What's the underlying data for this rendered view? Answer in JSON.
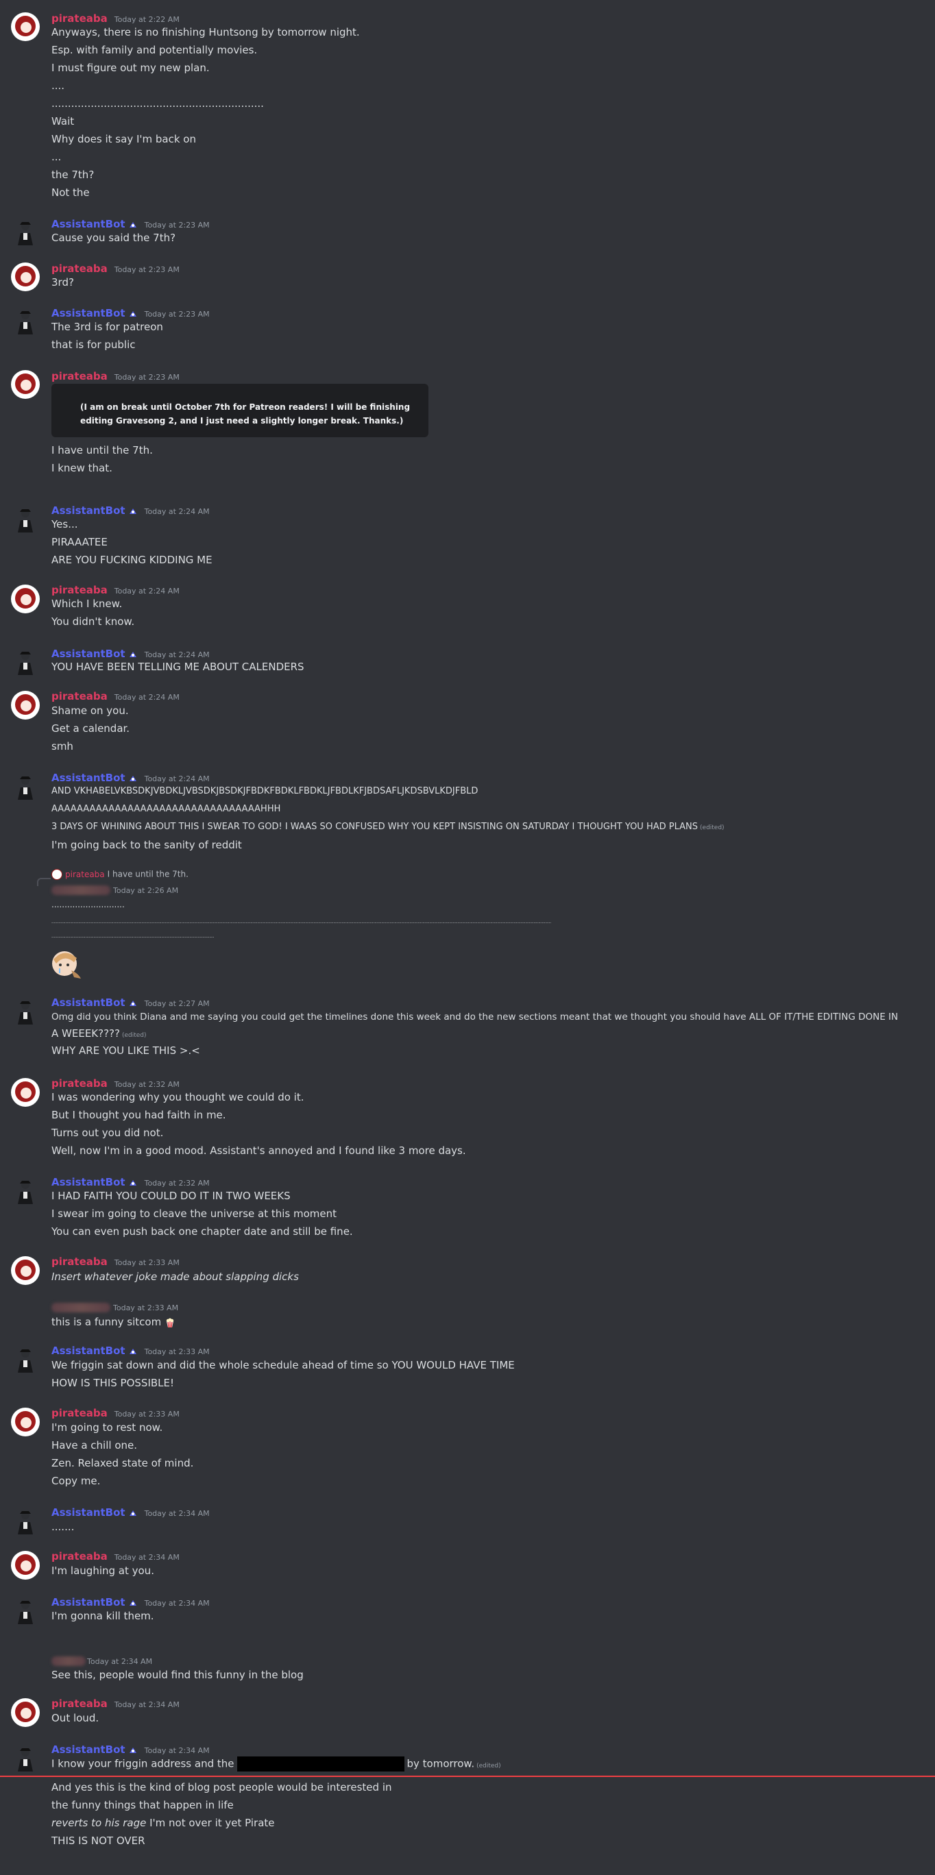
{
  "users": {
    "pirate": "pirateaba",
    "bot": "AssistantBot"
  },
  "colors": {
    "pirate": "#e03c62",
    "bot": "#5865f2",
    "background": "#313338"
  },
  "messages": {
    "m1": {
      "ts": "Today at 2:22 AM",
      "lines": [
        "Anyways, there is no finishing Huntsong by tomorrow night.",
        "Esp. with family and potentially movies.",
        "I must figure out my new plan.",
        "....",
        ".................................................................",
        "Wait",
        "Why does it say I'm back on",
        "...",
        "the 7th?",
        "Not the"
      ]
    },
    "m2": {
      "ts": "Today at 2:23 AM",
      "lines": [
        "Cause you said the 7th?"
      ]
    },
    "m3": {
      "ts": "Today at 2:23 AM",
      "lines": [
        "3rd?"
      ]
    },
    "m4": {
      "ts": "Today at 2:23 AM",
      "lines": [
        "The 3rd is for patreon",
        "that is for public"
      ]
    },
    "m5": {
      "ts": "Today at 2:23 AM",
      "embed": "(I am on break until October 7th for Patreon readers! I will be finishing editing Gravesong 2, and I just need a slightly longer break. Thanks.)",
      "lines": [
        "I have until the 7th.",
        "I knew that."
      ]
    },
    "m6": {
      "ts": "Today at 2:24 AM",
      "lines": [
        "Yes...",
        "PIRAAATEE",
        "ARE YOU FUCKING KIDDING ME"
      ]
    },
    "m7": {
      "ts": "Today at 2:24 AM",
      "lines": [
        "Which I knew.",
        "You didn't know."
      ]
    },
    "m8": {
      "ts": "Today at 2:24 AM",
      "lines": [
        "YOU HAVE BEEN TELLING ME ABOUT CALENDERS"
      ]
    },
    "m9": {
      "ts": "Today at 2:24 AM",
      "lines": [
        "Shame on you.",
        "Get a calendar.",
        "smh"
      ]
    },
    "m10": {
      "ts": "Today at 2:24 AM",
      "lines": [
        "AND VKHABELVKBSDKJVBDKLJVBSDKJBSDKJFBDKFBDKLFBDKLJFBDLKFJBDSAFLJKDSBVLKDJFBLD",
        "AAAAAAAAAAAAAAAAAAAAAAAAAAAAAAAAAHHH",
        "3 DAYS OF WHINING ABOUT THIS I SWEAR TO GOD! I WAAS SO CONFUSED WHY YOU KEPT INSISTING ON SATURDAY I THOUGHT YOU HAD PLANS",
        "I'm going back to the sanity of reddit"
      ],
      "edited": "(edited)"
    },
    "m11": {
      "reply_name": "pirateaba",
      "reply_text": "I have until the 7th.",
      "ts": "Today at 2:26 AM",
      "lines": [
        "............................",
        "...........................................................................................................................................................................................................................................................................................................................................................................................................................................",
        "..........................................................................................................................................."
      ],
      "sticker": "crying-sticker"
    },
    "m12": {
      "ts": "Today at 2:27 AM",
      "lines": [
        "Omg did you think Diana and me saying you could get the timelines done this week and do the new sections meant that we thought you should have ALL OF IT/THE EDITING DONE IN",
        "A WEEEK????",
        "WHY ARE YOU LIKE THIS >.<"
      ],
      "edited": "(edited)"
    },
    "m13": {
      "ts": "Today at 2:32 AM",
      "lines": [
        "I was wondering why you thought we could do it.",
        "But I thought you had faith in me.",
        "Turns out  you did not.",
        "Well, now I'm in a good mood. Assistant's annoyed and I found like 3 more days."
      ]
    },
    "m14": {
      "ts": "Today at 2:32 AM",
      "lines": [
        "I HAD FAITH YOU COULD DO IT IN TWO WEEKS",
        "I swear im going to cleave the universe at this moment",
        "You can even push back one chapter date and still be fine."
      ]
    },
    "m15": {
      "ts": "Today at 2:33 AM",
      "lines": [
        "Insert whatever joke made about slapping dicks"
      ]
    },
    "m16": {
      "ts": "Today at 2:33 AM",
      "lines": [
        "this is a funny sitcom"
      ],
      "emoji": "popcorn-emoji"
    },
    "m17": {
      "ts": "Today at 2:33 AM",
      "lines": [
        "We friggin sat down and did the whole schedule ahead of time so YOU WOULD HAVE TIME",
        "HOW IS THIS POSSIBLE!"
      ]
    },
    "m18": {
      "ts": "Today at 2:33 AM",
      "lines": [
        "I'm going to rest now.",
        "Have a chill one.",
        "Zen. Relaxed state of mind.",
        "Copy me."
      ]
    },
    "m19": {
      "ts": "Today at 2:34 AM",
      "lines": [
        "......."
      ]
    },
    "m20": {
      "ts": "Today at 2:34 AM",
      "lines": [
        "I'm laughing at you."
      ]
    },
    "m21": {
      "ts": "Today at 2:34 AM",
      "lines": [
        "I'm gonna kill them."
      ]
    },
    "m22": {
      "ts": "Today at 2:34 AM",
      "lines": [
        "See this, people would find this funny in the blog"
      ]
    },
    "m23": {
      "ts": "Today at 2:34 AM",
      "lines": [
        "Out loud."
      ]
    },
    "m24": {
      "ts": "Today at 2:34 AM",
      "line1_a": "I know your friggin address and the",
      "line1_b": "by tomorrow.",
      "edited": "(edited)",
      "lines": [
        "And yes this is the kind of blog post people would be interested in",
        "the funny things that happen in life",
        "reverts to his rage",
        " I'm not over it yet Pirate",
        "THIS IS NOT OVER"
      ]
    }
  }
}
